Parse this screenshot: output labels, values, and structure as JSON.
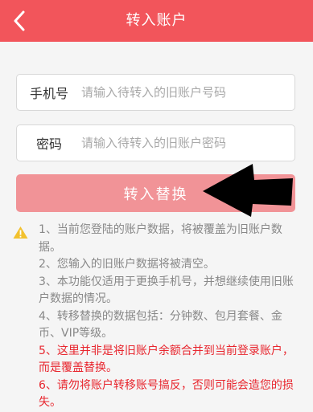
{
  "header": {
    "title": "转入账户"
  },
  "phone_field": {
    "label": "手机号",
    "placeholder": "请输入待转入的旧账户号码",
    "value": ""
  },
  "password_field": {
    "label": "密码",
    "placeholder": "请输入待转入的旧账户密码",
    "value": ""
  },
  "submit": {
    "label": "转入替换"
  },
  "notes": [
    {
      "text": "1、当前您登陆的账户数据，将被覆盖为旧账户数据。",
      "color": "#888888"
    },
    {
      "text": "2、您输入的旧账户数据将被清空。",
      "color": "#888888"
    },
    {
      "text": "3、本功能仅适用于更换手机号，并想继续使用旧账户数据的情况。",
      "color": "#888888"
    },
    {
      "text": "4、转移替换的数据包括：分钟数、包月套餐、金币、VIP等级。",
      "color": "#888888"
    },
    {
      "text": "5、这里并非是将旧账户余额合并到当前登录账户，而是覆盖替换。",
      "color": "#e8262e"
    },
    {
      "text": "6、请勿将账户转移账号搞反，否则可能会造您的损失。",
      "color": "#e8262e"
    }
  ],
  "colors": {
    "header": "#f2555b",
    "button": "#f19397",
    "warning_text": "#e8262e",
    "warning_icon": "#f2c12e"
  },
  "icons": {
    "back": "chevron-left-icon",
    "warning": "warning-triangle-icon",
    "annotation": "arrow-left-icon"
  }
}
